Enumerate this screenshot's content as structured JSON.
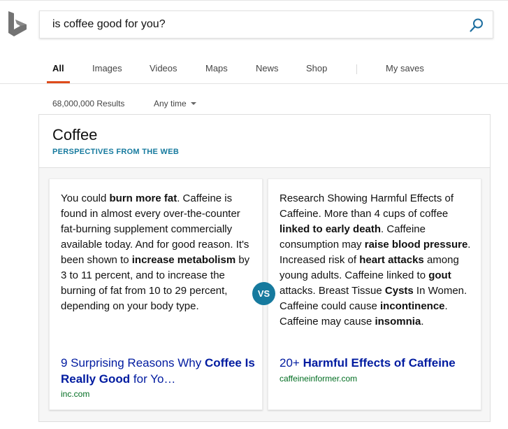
{
  "search": {
    "query": "is coffee good for you?",
    "search_icon": "search-icon"
  },
  "logo": {
    "icon": "bing-logo-icon"
  },
  "nav": {
    "tabs": [
      {
        "label": "All",
        "active": true
      },
      {
        "label": "Images"
      },
      {
        "label": "Videos"
      },
      {
        "label": "Maps"
      },
      {
        "label": "News"
      },
      {
        "label": "Shop"
      }
    ],
    "my_saves": "My saves",
    "accent_color": "#de4b1b"
  },
  "results": {
    "count": "68,000,000 Results",
    "time_filter": "Any time"
  },
  "panel": {
    "title": "Coffee",
    "subtitle": "PERSPECTIVES FROM THE WEB",
    "vs_label": "VS",
    "accent_color": "#167a9e",
    "left": {
      "body": [
        {
          "t": "You could "
        },
        {
          "t": "burn more fat",
          "b": true
        },
        {
          "t": ". Caffeine is found in almost every over-the-counter fat-burning supplement commercially available today. And for good reason. It's been shown to "
        },
        {
          "t": "increase metabolism",
          "b": true
        },
        {
          "t": " by 3 to 11 percent, and to increase the burning of fat from 10 to 29 percent, depending on your body type."
        }
      ],
      "link": [
        {
          "t": "9 Surprising Reasons Why "
        },
        {
          "t": "Coffee Is Really Good",
          "b": true
        },
        {
          "t": " for Yo…"
        }
      ],
      "source": "inc.com"
    },
    "right": {
      "body": [
        {
          "t": "Research Showing Harmful Effects of Caffeine. More than 4 cups of coffee "
        },
        {
          "t": "linked to early death",
          "b": true
        },
        {
          "t": ". Caffeine consumption may "
        },
        {
          "t": "raise blood pressure",
          "b": true
        },
        {
          "t": ". Increased risk of "
        },
        {
          "t": "heart attacks",
          "b": true
        },
        {
          "t": " among young adults. Caffeine linked to "
        },
        {
          "t": "gout",
          "b": true
        },
        {
          "t": " attacks. Breast Tissue "
        },
        {
          "t": "Cysts",
          "b": true
        },
        {
          "t": " In Women. Caffeine could cause "
        },
        {
          "t": "incontinence",
          "b": true
        },
        {
          "t": ". Caffeine may cause "
        },
        {
          "t": "insomnia",
          "b": true
        },
        {
          "t": "."
        }
      ],
      "link": [
        {
          "t": "20+ "
        },
        {
          "t": "Harmful Effects of Caffeine",
          "b": true
        }
      ],
      "source": "caffeineinformer.com"
    }
  }
}
